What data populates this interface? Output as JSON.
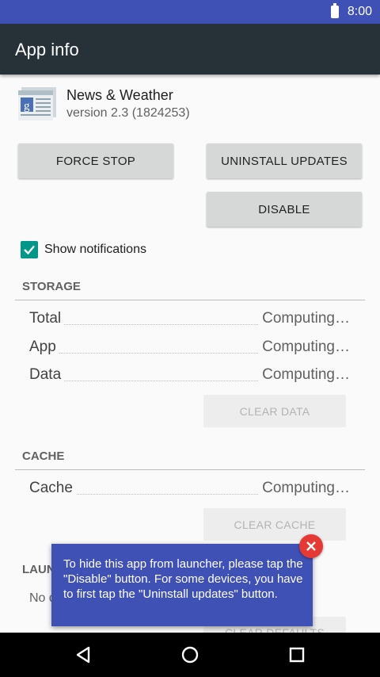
{
  "status_bar": {
    "time": "8:00",
    "battery_icon": "battery-icon"
  },
  "app_bar": {
    "title": "App info"
  },
  "app": {
    "name": "News & Weather",
    "version": "version 2.3 (1824253)",
    "icon": "google-news-icon"
  },
  "buttons": {
    "force_stop": "FORCE STOP",
    "uninstall_updates": "UNINSTALL UPDATES",
    "disable": "DISABLE"
  },
  "notifications": {
    "label": "Show notifications",
    "checked": true
  },
  "storage": {
    "header": "STORAGE",
    "rows": [
      {
        "label": "Total",
        "value": "Computing…"
      },
      {
        "label": "App",
        "value": "Computing…"
      },
      {
        "label": "Data",
        "value": "Computing…"
      }
    ],
    "clear_data": "CLEAR DATA"
  },
  "cache": {
    "header": "CACHE",
    "rows": [
      {
        "label": "Cache",
        "value": "Computing…"
      }
    ],
    "clear_cache": "CLEAR CACHE"
  },
  "launch": {
    "header_partial": "LAUN",
    "text_partial": "No d",
    "clear_defaults": "CLEAR DEFAULTS"
  },
  "toast": {
    "text": "To hide this app from launcher, please tap the \"Disable\" button. For some devices, you have to first tap the \"Uninstall updates\" button.",
    "close_icon": "close-icon"
  },
  "nav_bar": {
    "back": "back-icon",
    "home": "home-icon",
    "recents": "recents-icon"
  },
  "colors": {
    "accent": "#009688",
    "toast": "#3f51b5",
    "app_bar": "#263238",
    "status_bar": "#3f51b5",
    "close": "#e53935"
  }
}
